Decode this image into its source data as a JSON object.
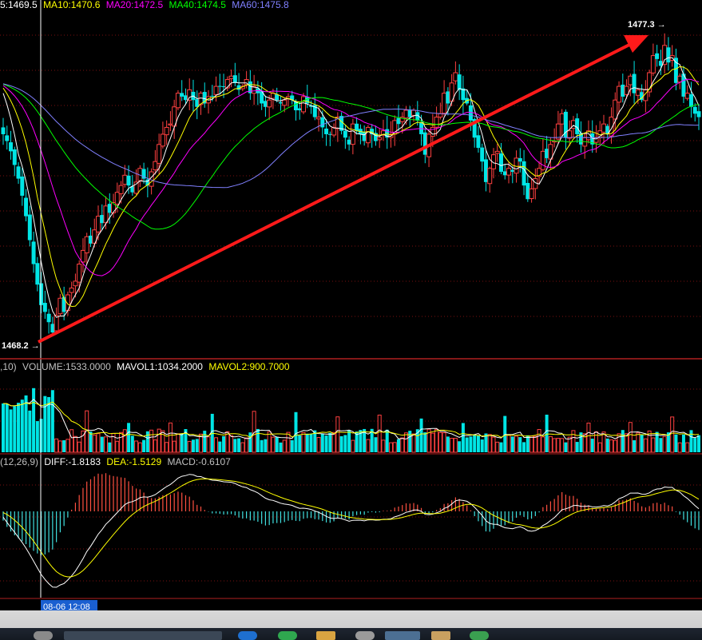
{
  "chart_data": {
    "type": "candlestick",
    "main": {
      "legend": [
        {
          "label": "5:1469.5",
          "color": "#ffffff"
        },
        {
          "label": "MA10:1470.6",
          "color": "#ffff00"
        },
        {
          "label": "MA20:1472.5",
          "color": "#ff00ff"
        },
        {
          "label": "MA40:1474.5",
          "color": "#00ff00"
        },
        {
          "label": "MA60:1475.8",
          "color": "#8080ff"
        }
      ],
      "high_label": "1477.3",
      "low_label": "1468.2",
      "ylim": [
        1467.9,
        1478.0
      ]
    },
    "volume": {
      "legend": [
        {
          "label": ",10)",
          "color": "#c0c0c0"
        },
        {
          "label": "VOLUME:1533.0000",
          "color": "#c0c0c0"
        },
        {
          "label": "MAVOL1:1034.2000",
          "color": "#ffffff"
        },
        {
          "label": "MAVOL2:900.7000",
          "color": "#ffff00"
        }
      ]
    },
    "macd": {
      "legend": [
        {
          "label": "(12,26,9)",
          "color": "#c0c0c0"
        },
        {
          "label": "DIFF:-1.8183",
          "color": "#ffffff"
        },
        {
          "label": "DEA:-1.5129",
          "color": "#ffff00"
        },
        {
          "label": "MACD:-0.6107",
          "color": "#c0c0c0"
        }
      ]
    },
    "crosshair_time": "08-06 12:08",
    "closes": [
      1474.4,
      1474.2,
      1473.9,
      1473.5,
      1473.1,
      1472.6,
      1472.0,
      1471.3,
      1470.6,
      1470.0,
      1469.4,
      1469.2,
      1468.9,
      1468.6,
      1469.1,
      1469.6,
      1469.2,
      1469.7,
      1469.9,
      1470.1,
      1470.6,
      1471.0,
      1471.4,
      1471.2,
      1471.6,
      1472.0,
      1471.8,
      1472.3,
      1472.1,
      1472.4,
      1472.7,
      1472.9,
      1473.2,
      1472.9,
      1472.7,
      1473.0,
      1473.4,
      1473.1,
      1472.9,
      1473.3,
      1473.6,
      1474.1,
      1474.4,
      1474.6,
      1474.7,
      1475.2,
      1475.6,
      1475.5,
      1475.4,
      1475.7,
      1475.4,
      1475.2,
      1475.6,
      1475.3,
      1475.5,
      1475.5,
      1475.8,
      1475.8,
      1475.8,
      1476.0,
      1476.1,
      1475.9,
      1475.7,
      1475.8,
      1476.0,
      1475.6,
      1475.8,
      1475.6,
      1475.3,
      1475.2,
      1475.4,
      1475.6,
      1475.4,
      1475.3,
      1475.4,
      1475.5,
      1475.4,
      1475.1,
      1475.1,
      1475.5,
      1475.3,
      1475.2,
      1474.9,
      1474.9,
      1474.6,
      1474.4,
      1474.4,
      1474.6,
      1474.9,
      1474.5,
      1474.3,
      1474.1,
      1474.7,
      1474.5,
      1474.4,
      1474.2,
      1474.6,
      1474.4,
      1474.2,
      1474.3,
      1474.5,
      1474.3,
      1474.4,
      1474.8,
      1474.7,
      1474.9,
      1475.1,
      1474.9,
      1475.1,
      1474.8,
      1474.4,
      1473.8,
      1474.4,
      1474.6,
      1474.9,
      1475.0,
      1475.6,
      1475.3,
      1475.9,
      1476.2,
      1475.7,
      1475.4,
      1475.3,
      1474.8,
      1474.3,
      1474.0,
      1473.6,
      1473.0,
      1473.4,
      1473.8,
      1473.9,
      1473.3,
      1473.2,
      1473.4,
      1473.3,
      1473.7,
      1473.6,
      1472.9,
      1472.5,
      1472.8,
      1473.1,
      1473.4,
      1473.9,
      1473.7,
      1474.1,
      1474.2,
      1474.7,
      1475.0,
      1474.3,
      1474.5,
      1474.8,
      1474.4,
      1474.1,
      1474.3,
      1474.5,
      1474.1,
      1474.3,
      1474.5,
      1474.7,
      1474.4,
      1474.9,
      1475.4,
      1475.8,
      1475.5,
      1475.8,
      1476.1,
      1475.6,
      1475.7,
      1475.4,
      1475.7,
      1476.2,
      1476.7,
      1476.6,
      1476.4,
      1477.0,
      1476.5,
      1476.7,
      1475.9,
      1476.1,
      1475.5,
      1475.6,
      1475.2,
      1475.0,
      1474.9
    ]
  }
}
